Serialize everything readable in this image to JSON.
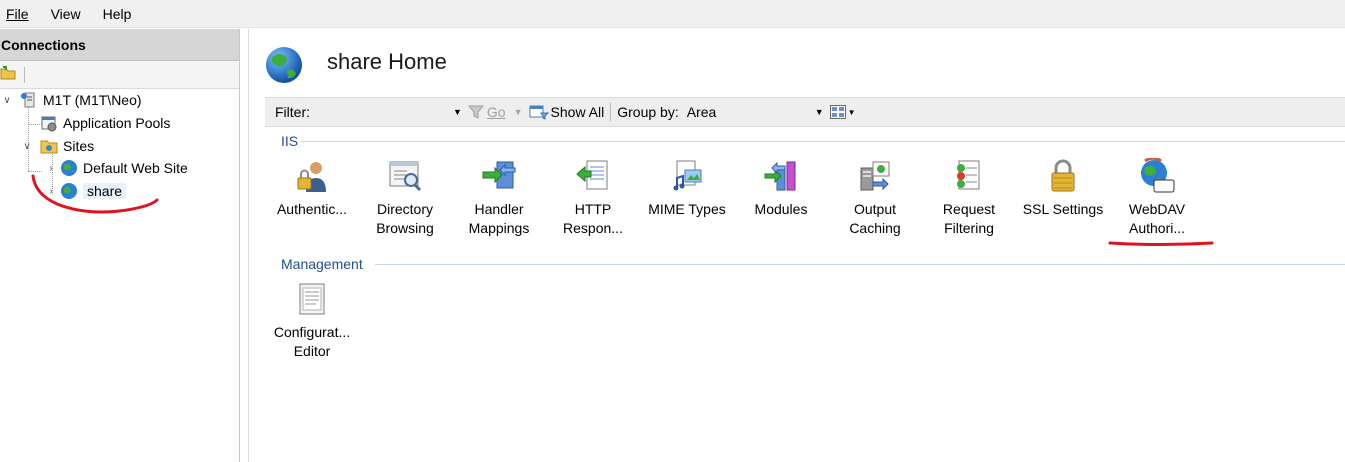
{
  "menu": {
    "file": "File",
    "view": "View",
    "help": "Help"
  },
  "connections": {
    "header": "Connections",
    "tree": {
      "server": "M1T (M1T\\Neo)",
      "app_pools": "Application Pools",
      "sites": "Sites",
      "default_site": "Default Web Site",
      "share": "share"
    }
  },
  "page": {
    "title": "share Home"
  },
  "filterbar": {
    "filter_label": "Filter:",
    "filter_value": "",
    "go_label": "Go",
    "show_all_label": "Show All",
    "group_by_label": "Group by:",
    "group_by_value": "Area"
  },
  "groups": {
    "iis": {
      "label": "IIS",
      "features": [
        {
          "line1": "Authentic...",
          "line2": "",
          "icon": "authentication-icon"
        },
        {
          "line1": "Directory",
          "line2": "Browsing",
          "icon": "directory-browsing-icon"
        },
        {
          "line1": "Handler",
          "line2": "Mappings",
          "icon": "handler-mappings-icon"
        },
        {
          "line1": "HTTP",
          "line2": "Respon...",
          "icon": "http-response-icon"
        },
        {
          "line1": "MIME Types",
          "line2": "",
          "icon": "mime-types-icon"
        },
        {
          "line1": "Modules",
          "line2": "",
          "icon": "modules-icon"
        },
        {
          "line1": "Output",
          "line2": "Caching",
          "icon": "output-caching-icon"
        },
        {
          "line1": "Request",
          "line2": "Filtering",
          "icon": "request-filtering-icon"
        },
        {
          "line1": "SSL Settings",
          "line2": "",
          "icon": "ssl-settings-icon"
        },
        {
          "line1": "WebDAV",
          "line2": "Authori...",
          "icon": "webdav-authoring-icon"
        }
      ]
    },
    "management": {
      "label": "Management",
      "features": [
        {
          "line1": "Configurat...",
          "line2": "Editor",
          "icon": "configuration-editor-icon"
        }
      ]
    }
  },
  "colors": {
    "group_label": "#1f4f8f",
    "selection": "#e5f1fb",
    "annotation": "#e0141e"
  }
}
